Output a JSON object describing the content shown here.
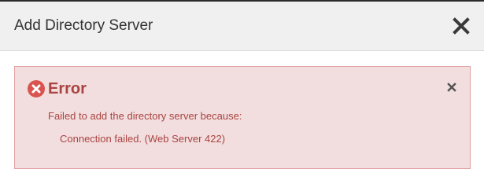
{
  "dialog": {
    "title": "Add Directory Server",
    "close_icon": "close-icon"
  },
  "alert": {
    "title": "Error",
    "icon": "error-circle-icon",
    "dismiss_icon": "close-icon",
    "message": "Failed to add the directory server because:",
    "detail": "Connection failed. (Web Server 422)"
  },
  "colors": {
    "header_bg": "#f0f0f0",
    "alert_bg": "#f2dede",
    "alert_border": "#e4a0a4",
    "alert_text": "#a94442",
    "error_icon": "#d9534f"
  }
}
